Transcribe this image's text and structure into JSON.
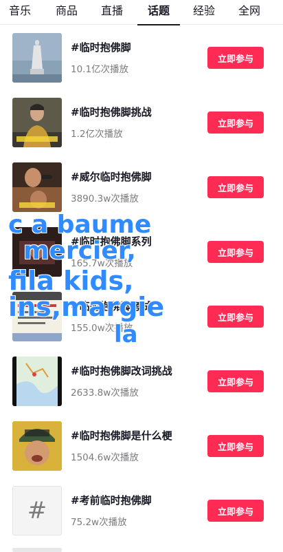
{
  "tabs": [
    {
      "label": "音乐"
    },
    {
      "label": "商品"
    },
    {
      "label": "直播"
    },
    {
      "label": "话题"
    },
    {
      "label": "经验"
    },
    {
      "label": "全网"
    }
  ],
  "active_tab": "话题",
  "join_label": "立即参与",
  "topics": [
    {
      "title": "#临时抱佛脚",
      "plays": "10.1亿次播放",
      "thumb": "statue"
    },
    {
      "title": "#临时抱佛脚挑战",
      "plays": "1.2亿次播放",
      "thumb": "person-hoodie"
    },
    {
      "title": "#威尔临时抱佛脚",
      "plays": "3890.3w次播放",
      "thumb": "person-mic"
    },
    {
      "title": "#临时抱佛脚系列",
      "plays": "165.7w次播放",
      "thumb": "dark-scene"
    },
    {
      "title": "#临时抱佛脚考试",
      "plays": "155.0w次播放",
      "thumb": "exam-note"
    },
    {
      "title": "#临时抱佛脚改词挑战",
      "plays": "2633.8w次播放",
      "thumb": "map"
    },
    {
      "title": "#临时抱佛脚是什么梗",
      "plays": "1504.6w次播放",
      "thumb": "person-cap"
    },
    {
      "title": "#考前临时抱佛脚",
      "plays": "75.2w次播放",
      "thumb": "hash"
    }
  ],
  "watermark": {
    "lines": [
      "c a baume",
      "mercier,",
      "fila kids,",
      "ins,margie",
      "la"
    ],
    "color": "#2f8bff"
  },
  "thumb_hash_glyph": "#"
}
